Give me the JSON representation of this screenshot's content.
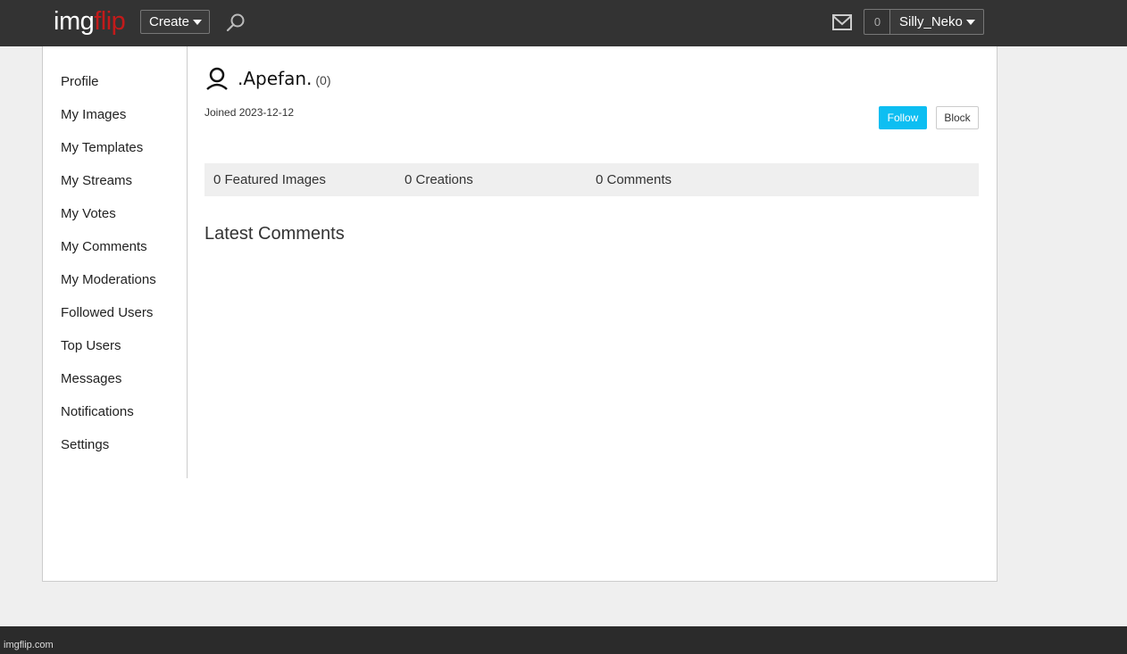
{
  "header": {
    "logo_img": "img",
    "logo_flip": "flip",
    "create_label": "Create",
    "notification_count": "0",
    "username": "Silly_Neko",
    "icons": [
      "search-icon",
      "mail-icon",
      "chevron-down-icon"
    ]
  },
  "sidebar": {
    "items": [
      {
        "label": "Profile"
      },
      {
        "label": "My Images"
      },
      {
        "label": "My Templates"
      },
      {
        "label": "My Streams"
      },
      {
        "label": "My Votes"
      },
      {
        "label": "My Comments"
      },
      {
        "label": "My Moderations"
      },
      {
        "label": "Followed Users"
      },
      {
        "label": "Top Users"
      },
      {
        "label": "Messages"
      },
      {
        "label": "Notifications"
      },
      {
        "label": "Settings"
      }
    ]
  },
  "profile": {
    "name": ".Apefan.",
    "points": "(0)",
    "joined": "Joined 2023-12-12",
    "follow_label": "Follow",
    "block_label": "Block",
    "stats": {
      "featured": "0 Featured Images",
      "creations": "0 Creations",
      "comments": "0 Comments"
    },
    "latest_comments_heading": "Latest Comments"
  },
  "footer": {
    "domain": "imgflip.com"
  },
  "colors": {
    "topbar": "#333333",
    "logo_accent": "#c31a1a",
    "follow_button": "#0dbef2",
    "page_bg": "#efefef"
  }
}
